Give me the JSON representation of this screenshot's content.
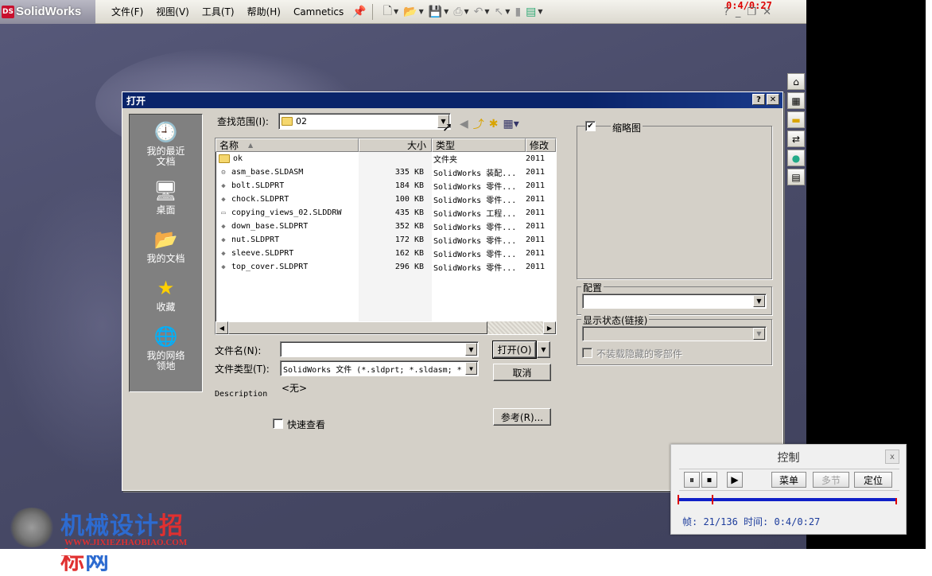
{
  "app": {
    "logo_text": "SolidWorks",
    "menu": [
      "文件(F)",
      "视图(V)",
      "工具(T)",
      "帮助(H)",
      "Camnetics"
    ],
    "timer": "0:4/0:27"
  },
  "dialog": {
    "title": "打开",
    "help_btn": "?",
    "close_btn": "✕",
    "look_in_label": "查找范围(I):",
    "look_in_value": "02",
    "places": [
      {
        "icon": "recent-documents-icon",
        "label": "我的最近\n文档"
      },
      {
        "icon": "desktop-icon",
        "label": "桌面"
      },
      {
        "icon": "my-documents-icon",
        "label": "我的文档"
      },
      {
        "icon": "favorites-star-icon",
        "label": "收藏"
      },
      {
        "icon": "network-places-icon",
        "label": "我的网络\n领地"
      }
    ],
    "columns": {
      "name": "名称",
      "size": "大小",
      "type": "类型",
      "modified": "修改"
    },
    "files": [
      {
        "name": "ok",
        "size": "",
        "type": "文件夹",
        "modified": "2011",
        "kind": "folder"
      },
      {
        "name": "asm_base.SLDASM",
        "size": "335 KB",
        "type": "SolidWorks 装配...",
        "modified": "2011",
        "kind": "asm"
      },
      {
        "name": "bolt.SLDPRT",
        "size": "184 KB",
        "type": "SolidWorks 零件...",
        "modified": "2011",
        "kind": "part"
      },
      {
        "name": "chock.SLDPRT",
        "size": "100 KB",
        "type": "SolidWorks 零件...",
        "modified": "2011",
        "kind": "part"
      },
      {
        "name": "copying_views_02.SLDDRW",
        "size": "435 KB",
        "type": "SolidWorks 工程...",
        "modified": "2011",
        "kind": "drw"
      },
      {
        "name": "down_base.SLDPRT",
        "size": "352 KB",
        "type": "SolidWorks 零件...",
        "modified": "2011",
        "kind": "part"
      },
      {
        "name": "nut.SLDPRT",
        "size": "172 KB",
        "type": "SolidWorks 零件...",
        "modified": "2011",
        "kind": "part"
      },
      {
        "name": "sleeve.SLDPRT",
        "size": "162 KB",
        "type": "SolidWorks 零件...",
        "modified": "2011",
        "kind": "part"
      },
      {
        "name": "top_cover.SLDPRT",
        "size": "296 KB",
        "type": "SolidWorks 零件...",
        "modified": "2011",
        "kind": "part"
      }
    ],
    "filename_label": "文件名(N):",
    "filename_value": "",
    "filetype_label": "文件类型(T):",
    "filetype_value": "SolidWorks 文件 (*.sldprt; *.sldasm; *",
    "none_text": "<无>",
    "description_label": "Description",
    "quickview_label": "快速查看",
    "open_btn": "打开(O)",
    "cancel_btn": "取消",
    "reference_btn": "参考(R)...",
    "thumbnail_label": "缩略图",
    "thumbnail_checked": true,
    "config_label": "配置",
    "display_state_label": "显示状态(链接)",
    "dont_load_hidden_label": "不装载隐藏的零部件"
  },
  "control_panel": {
    "title": "控制",
    "close": "x",
    "menu_btn": "菜单",
    "section_btn": "多节",
    "locate_btn": "定位",
    "info_text": "帧: 21/136 时间: 0:4/0:27",
    "progress_fraction": 0.154
  },
  "watermark": {
    "brand_blue": "机械设计",
    "brand_red": "招标",
    "brand_blue2": "网",
    "url": "WWW.JIXIEZHAOBIAO.COM"
  }
}
